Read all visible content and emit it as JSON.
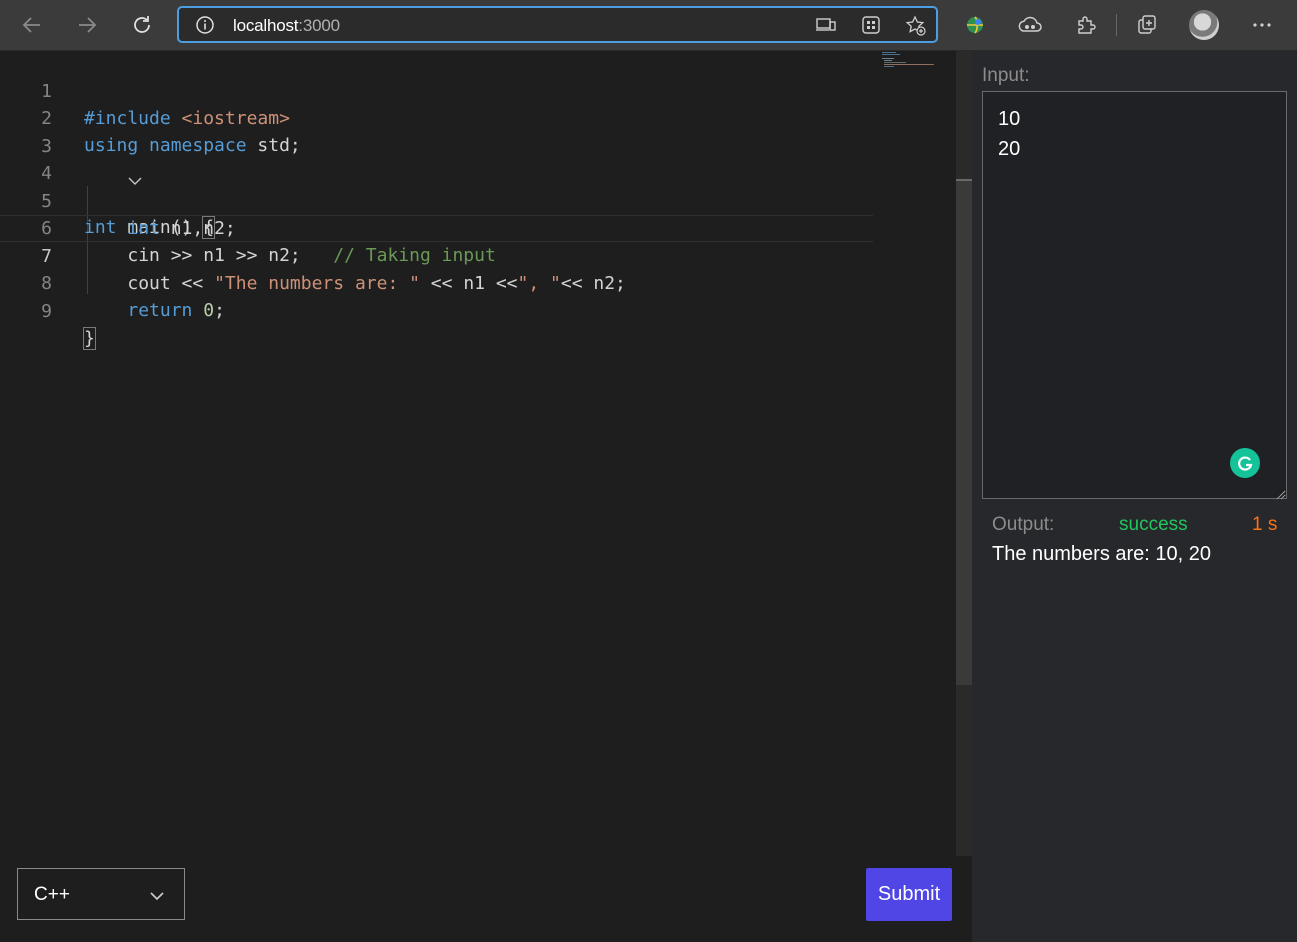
{
  "browser": {
    "url_host": "localhost",
    "url_port": ":3000",
    "icons": [
      "back-arrow-icon",
      "forward-arrow-icon",
      "refresh-icon",
      "info-icon",
      "device-icon",
      "apps-icon",
      "add-favorite-icon",
      "extension-globe-icon",
      "cloud-extension-icon",
      "puzzle-icon",
      "collections-icon",
      "profile-avatar",
      "more-icon"
    ]
  },
  "editor": {
    "lines": [
      {
        "n": "1"
      },
      {
        "n": "2"
      },
      {
        "n": "3"
      },
      {
        "n": "4"
      },
      {
        "n": "5"
      },
      {
        "n": "6"
      },
      {
        "n": "7"
      },
      {
        "n": "8"
      },
      {
        "n": "9"
      }
    ],
    "code": {
      "l1_kw": "#include",
      "l1_inc": "<iostream>",
      "l2_kw1": "using",
      "l2_kw2": "namespace",
      "l2_rest": "std;",
      "l4_kw": "int",
      "l4_rest": "main()",
      "l4_brace": "{",
      "l5_kw": "int",
      "l5_rest": "n1,n2;",
      "l6_code": "cin >> n1 >> n2;",
      "l6_comment": "// Taking input",
      "l7_a": "cout << ",
      "l7_str1": "\"The numbers are: \"",
      "l7_b": " << n1 <<",
      "l7_str2": "\", \"",
      "l7_c": "<< n2;",
      "l8_kw": "return",
      "l8_num": "0",
      "l8_end": ";",
      "l9_brace": "}"
    },
    "current_line": 7
  },
  "controls": {
    "language": "C++",
    "submit_label": "Submit"
  },
  "panel": {
    "input_label": "Input:",
    "input_value": "10\n20",
    "output_label": "Output:",
    "status": "success",
    "time": "1 s",
    "output_text": "The numbers are: 10, 20"
  },
  "colors": {
    "accent": "#4f46e5",
    "success": "#22c55e",
    "time": "#f97316",
    "address_border": "#4c9ee3"
  }
}
